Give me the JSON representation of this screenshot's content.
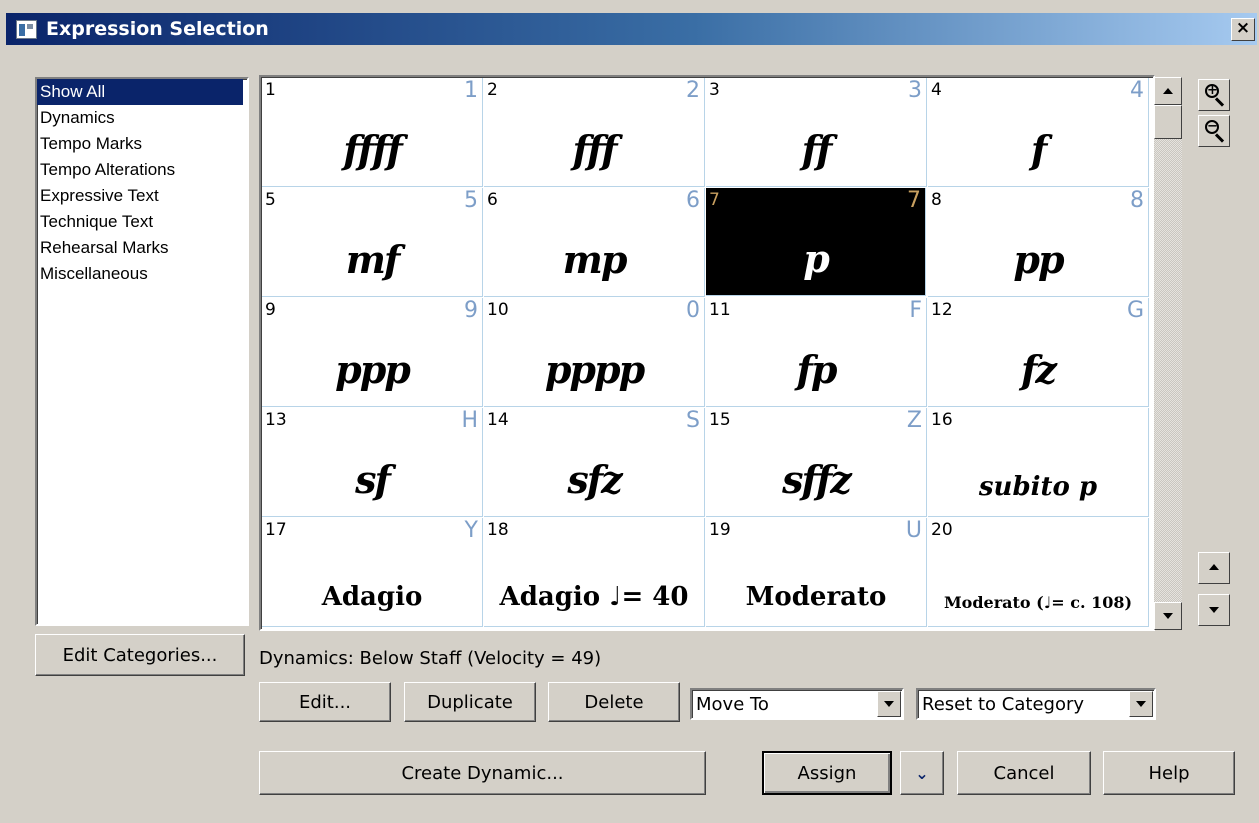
{
  "window": {
    "title": "Expression Selection",
    "close_label": "×"
  },
  "categories": {
    "items": [
      {
        "label": "Show All",
        "selected": true
      },
      {
        "label": "Dynamics"
      },
      {
        "label": "Tempo Marks"
      },
      {
        "label": "Tempo Alterations"
      },
      {
        "label": "Expressive Text"
      },
      {
        "label": "Technique Text"
      },
      {
        "label": "Rehearsal Marks"
      },
      {
        "label": "Miscellaneous"
      }
    ],
    "edit_button": "Edit Categories..."
  },
  "expressions": [
    {
      "num": "1",
      "key": "1",
      "text": "ffff",
      "style": "dyn"
    },
    {
      "num": "2",
      "key": "2",
      "text": "fff",
      "style": "dyn"
    },
    {
      "num": "3",
      "key": "3",
      "text": "ff",
      "style": "dyn"
    },
    {
      "num": "4",
      "key": "4",
      "text": "f",
      "style": "dyn"
    },
    {
      "num": "5",
      "key": "5",
      "text": "mf",
      "style": "dyn"
    },
    {
      "num": "6",
      "key": "6",
      "text": "mp",
      "style": "dyn"
    },
    {
      "num": "7",
      "key": "7",
      "text": "p",
      "style": "dyn",
      "selected": true
    },
    {
      "num": "8",
      "key": "8",
      "text": "pp",
      "style": "dyn"
    },
    {
      "num": "9",
      "key": "9",
      "text": "ppp",
      "style": "dyn"
    },
    {
      "num": "10",
      "key": "0",
      "text": "pppp",
      "style": "dyn"
    },
    {
      "num": "11",
      "key": "F",
      "text": "fp",
      "style": "dyn"
    },
    {
      "num": "12",
      "key": "G",
      "text": "fz",
      "style": "dyn"
    },
    {
      "num": "13",
      "key": "H",
      "text": "sf",
      "style": "dyn"
    },
    {
      "num": "14",
      "key": "S",
      "text": "sfz",
      "style": "dyn"
    },
    {
      "num": "15",
      "key": "Z",
      "text": "sffz",
      "style": "dyn"
    },
    {
      "num": "16",
      "key": "",
      "text": "subito p",
      "style": "small"
    },
    {
      "num": "17",
      "key": "Y",
      "text": "Adagio",
      "style": "text"
    },
    {
      "num": "18",
      "key": "",
      "text": "Adagio ♩= 40",
      "style": "text"
    },
    {
      "num": "19",
      "key": "U",
      "text": "Moderato",
      "style": "text"
    },
    {
      "num": "20",
      "key": "",
      "text": "Moderato (♩= c. 108)",
      "style": "text-small"
    }
  ],
  "status": "Dynamics: Below Staff (Velocity = 49)",
  "actions": {
    "edit": "Edit...",
    "duplicate": "Duplicate",
    "delete": "Delete",
    "move_to": "Move To",
    "reset": "Reset to Category",
    "create": "Create Dynamic...",
    "assign": "Assign",
    "assign_menu": "⌄",
    "cancel": "Cancel",
    "help": "Help"
  },
  "icons": {
    "zoom_in": "zoom-in-icon",
    "zoom_out": "zoom-out-icon",
    "scroll_up": "arrow-up-icon",
    "scroll_down": "arrow-down-icon"
  },
  "colors": {
    "selection": "#0a246a",
    "shortcut_key": "#7d9ec8",
    "cell_grid": "#b8d4e8"
  }
}
